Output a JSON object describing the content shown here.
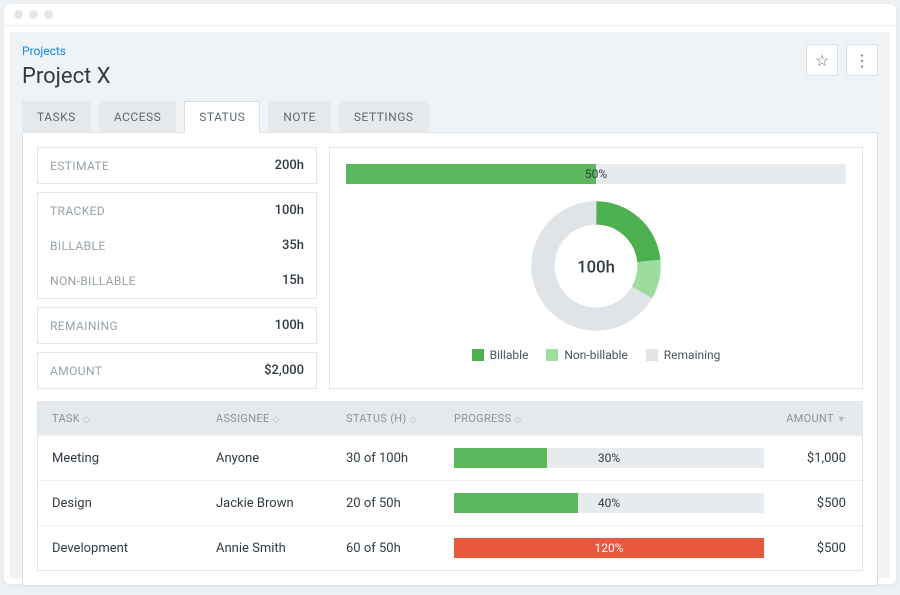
{
  "breadcrumb": "Projects",
  "project_title": "Project X",
  "icons": {
    "star": "☆",
    "more": "⋮"
  },
  "tabs": [
    {
      "label": "TASKS",
      "active": false
    },
    {
      "label": "ACCESS",
      "active": false
    },
    {
      "label": "STATUS",
      "active": true
    },
    {
      "label": "NOTE",
      "active": false
    },
    {
      "label": "SETTINGS",
      "active": false
    }
  ],
  "stats": {
    "estimate_label": "ESTIMATE",
    "estimate_value": "200h",
    "tracked_label": "TRACKED",
    "tracked_value": "100h",
    "billable_label": "BILLABLE",
    "billable_value": "35h",
    "nonbillable_label": "NON-BILLABLE",
    "nonbillable_value": "15h",
    "remaining_label": "REMAINING",
    "remaining_value": "100h",
    "amount_label": "AMOUNT",
    "amount_value": "$2,000"
  },
  "chart_data": {
    "type": "pie",
    "progress_percent": 50,
    "progress_label": "50%",
    "center_label": "100h",
    "series": [
      {
        "name": "Billable",
        "value": 35,
        "color": "#4CAF50"
      },
      {
        "name": "Non-billable",
        "value": 15,
        "color": "#9CDC9E"
      },
      {
        "name": "Remaining",
        "value": 100,
        "color": "#E0E4E7"
      }
    ],
    "total": 150,
    "legend": [
      "Billable",
      "Non-billable",
      "Remaining"
    ]
  },
  "table": {
    "headers": {
      "task": "TASK",
      "assignee": "ASSIGNEE",
      "status": "STATUS (h)",
      "progress": "PROGRESS",
      "amount": "AMOUNT"
    },
    "rows": [
      {
        "task": "Meeting",
        "assignee": "Anyone",
        "status": "30 of 100h",
        "progress_pct": 30,
        "progress_label": "30%",
        "amount": "$1,000",
        "color": "#5cb85c"
      },
      {
        "task": "Design",
        "assignee": "Jackie Brown",
        "status": "20 of 50h",
        "progress_pct": 40,
        "progress_label": "40%",
        "amount": "$500",
        "color": "#5cb85c"
      },
      {
        "task": "Development",
        "assignee": "Annie Smith",
        "status": "60 of 50h",
        "progress_pct": 120,
        "progress_label": "120%",
        "amount": "$500",
        "color": "#e9573f"
      }
    ]
  }
}
